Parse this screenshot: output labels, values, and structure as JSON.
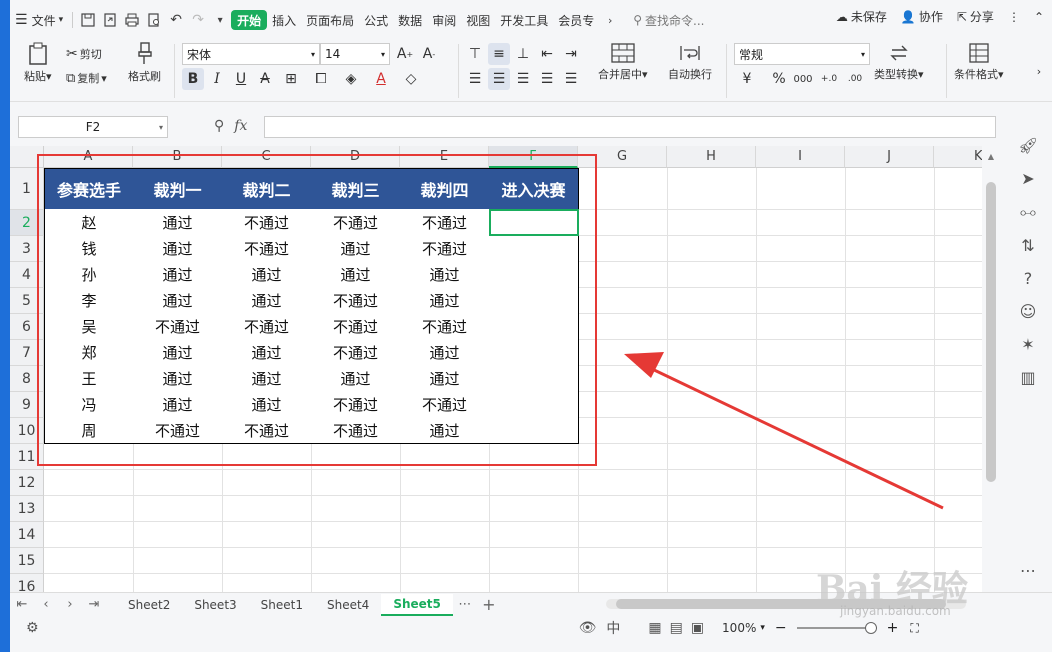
{
  "menubar": {
    "file": "文件",
    "tabs": [
      "开始",
      "插入",
      "页面布局",
      "公式",
      "数据",
      "审阅",
      "视图",
      "开发工具",
      "会员专"
    ],
    "search_placeholder": "查找命令...",
    "unsaved": "未保存",
    "collab": "协作",
    "share": "分享"
  },
  "ribbon": {
    "paste": "粘贴",
    "cut": "剪切",
    "copy": "复制",
    "format_painter": "格式刷",
    "font_name": "宋体",
    "font_size": "14",
    "merge_center": "合并居中",
    "wrap_text": "自动换行",
    "number_format": "常规",
    "type_convert": "类型转换",
    "cond_format": "条件格式"
  },
  "formula_bar": {
    "name_box": "F2",
    "fx": "fx"
  },
  "grid": {
    "columns": [
      "A",
      "B",
      "C",
      "D",
      "E",
      "F",
      "G",
      "H",
      "I",
      "J",
      "K"
    ],
    "rows": [
      "1",
      "2",
      "3",
      "4",
      "5",
      "6",
      "7",
      "8",
      "9",
      "10",
      "11",
      "12",
      "13",
      "14",
      "15",
      "16"
    ],
    "selected_col": "F",
    "selected_row": "2"
  },
  "table": {
    "headers": [
      "参赛选手",
      "裁判一",
      "裁判二",
      "裁判三",
      "裁判四",
      "进入决赛"
    ],
    "rows": [
      [
        "赵",
        "通过",
        "不通过",
        "不通过",
        "不通过",
        ""
      ],
      [
        "钱",
        "通过",
        "不通过",
        "通过",
        "不通过",
        ""
      ],
      [
        "孙",
        "通过",
        "通过",
        "通过",
        "通过",
        ""
      ],
      [
        "李",
        "通过",
        "通过",
        "不通过",
        "通过",
        ""
      ],
      [
        "吴",
        "不通过",
        "不通过",
        "不通过",
        "不通过",
        ""
      ],
      [
        "郑",
        "通过",
        "通过",
        "不通过",
        "通过",
        ""
      ],
      [
        "王",
        "通过",
        "通过",
        "通过",
        "通过",
        ""
      ],
      [
        "冯",
        "通过",
        "通过",
        "不通过",
        "不通过",
        ""
      ],
      [
        "周",
        "不通过",
        "不通过",
        "不通过",
        "通过",
        ""
      ]
    ]
  },
  "sheets": {
    "tabs": [
      "Sheet2",
      "Sheet3",
      "Sheet1",
      "Sheet4",
      "Sheet5"
    ],
    "active": "Sheet5"
  },
  "status": {
    "zoom": "100%"
  },
  "watermark": {
    "text": "Bai 经验",
    "url": "jingyan.baidu.com"
  },
  "colors": {
    "accent": "#1aad5d",
    "header_bg": "#2f5597",
    "annotation": "#e53935"
  }
}
